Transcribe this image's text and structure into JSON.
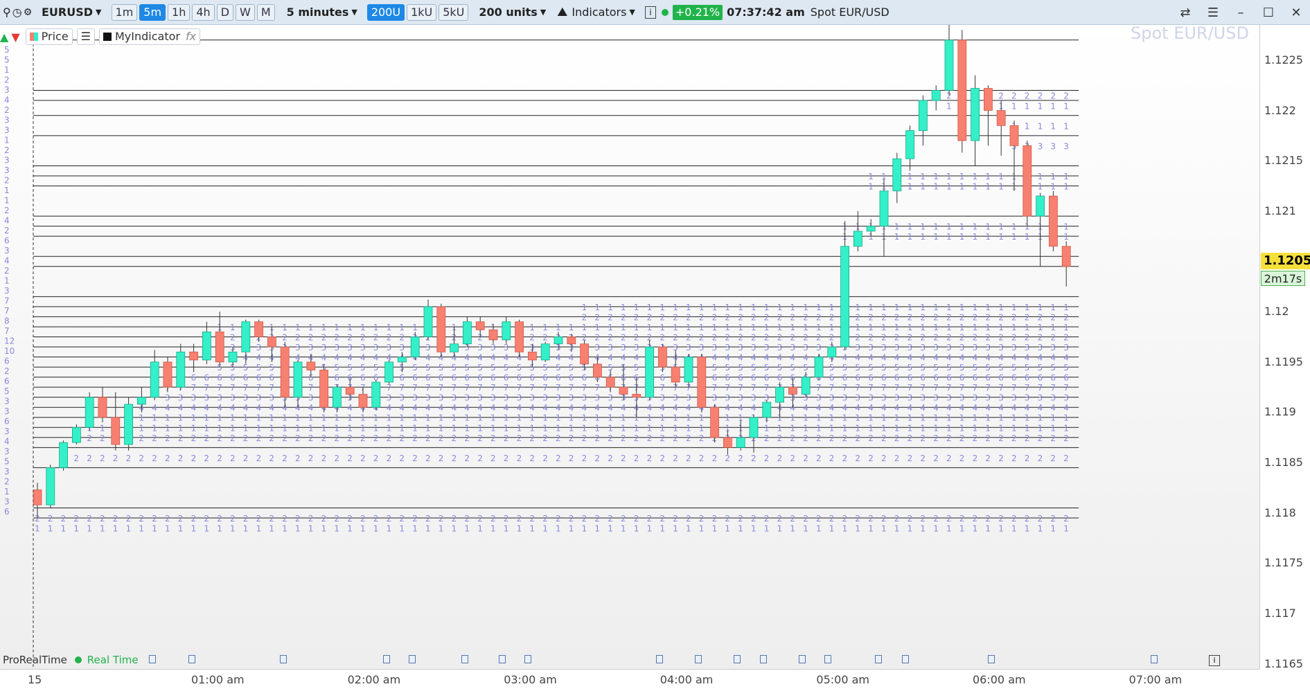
{
  "toolbar": {
    "symbol": "EURUSD",
    "timeframes": [
      "1m",
      "5m",
      "1h",
      "4h",
      "D",
      "W",
      "M"
    ],
    "active_timeframe": "5m",
    "interval": "5 minutes",
    "unit_buttons": [
      "200U",
      "1kU",
      "5kU"
    ],
    "active_unit": "200U",
    "units": "200 units",
    "indicators_label": "Indicators",
    "change": "+0.21%",
    "time": "07:37:42 am",
    "instrument": "Spot EUR/USD"
  },
  "legend": {
    "price_label": "Price",
    "indicator_label": "MyIndicator"
  },
  "watermark": "Spot EUR/USD",
  "current_price": "1.1205",
  "countdown": "2m17s",
  "footer": {
    "brand": "ProRealTime",
    "status": "Real Time"
  },
  "colors": {
    "bull": "#33f0c8",
    "bear": "#f88070",
    "profile_text": "#8888dd",
    "status_green": "#21b34b"
  },
  "chart_data": {
    "type": "candlestick",
    "y_ticks": [
      "1.1225",
      "1.122",
      "1.1215",
      "1.121",
      "1.1205",
      "1.12",
      "1.1195",
      "1.119",
      "1.1185",
      "1.118",
      "1.1175",
      "1.117",
      "1.1165"
    ],
    "x_ticks": [
      "15",
      "01:00 am",
      "02:00 am",
      "03:00 am",
      "04:00 am",
      "05:00 am",
      "06:00 am",
      "07:00 am"
    ],
    "ylim": [
      1.11645,
      1.12285
    ],
    "candles": [
      {
        "o": 1.11823,
        "c": 1.11808,
        "h": 1.1183,
        "l": 1.11795
      },
      {
        "o": 1.11808,
        "c": 1.11845,
        "h": 1.11848,
        "l": 1.11805
      },
      {
        "o": 1.11845,
        "c": 1.1187,
        "h": 1.11872,
        "l": 1.11842
      },
      {
        "o": 1.1187,
        "c": 1.11885,
        "h": 1.11888,
        "l": 1.11868
      },
      {
        "o": 1.11885,
        "c": 1.11915,
        "h": 1.1192,
        "l": 1.11882
      },
      {
        "o": 1.11915,
        "c": 1.11895,
        "h": 1.11925,
        "l": 1.1189
      },
      {
        "o": 1.11895,
        "c": 1.11868,
        "h": 1.1192,
        "l": 1.11862
      },
      {
        "o": 1.11868,
        "c": 1.11908,
        "h": 1.11915,
        "l": 1.11862
      },
      {
        "o": 1.11908,
        "c": 1.11915,
        "h": 1.11925,
        "l": 1.119
      },
      {
        "o": 1.11915,
        "c": 1.1195,
        "h": 1.11962,
        "l": 1.11912
      },
      {
        "o": 1.1195,
        "c": 1.11925,
        "h": 1.11955,
        "l": 1.1192
      },
      {
        "o": 1.11925,
        "c": 1.1196,
        "h": 1.11968,
        "l": 1.11922
      },
      {
        "o": 1.1196,
        "c": 1.11952,
        "h": 1.11968,
        "l": 1.1194
      },
      {
        "o": 1.11952,
        "c": 1.1198,
        "h": 1.1199,
        "l": 1.11948
      },
      {
        "o": 1.1198,
        "c": 1.1195,
        "h": 1.12,
        "l": 1.11945
      },
      {
        "o": 1.1195,
        "c": 1.1196,
        "h": 1.11965,
        "l": 1.11945
      },
      {
        "o": 1.1196,
        "c": 1.1199,
        "h": 1.11992,
        "l": 1.11948
      },
      {
        "o": 1.1199,
        "c": 1.11975,
        "h": 1.11992,
        "l": 1.1197
      },
      {
        "o": 1.11975,
        "c": 1.11965,
        "h": 1.11985,
        "l": 1.1195
      },
      {
        "o": 1.11965,
        "c": 1.11915,
        "h": 1.1197,
        "l": 1.11905
      },
      {
        "o": 1.11915,
        "c": 1.1195,
        "h": 1.11952,
        "l": 1.11905
      },
      {
        "o": 1.1195,
        "c": 1.11942,
        "h": 1.11958,
        "l": 1.11935
      },
      {
        "o": 1.11942,
        "c": 1.11905,
        "h": 1.11948,
        "l": 1.119
      },
      {
        "o": 1.11905,
        "c": 1.11925,
        "h": 1.11928,
        "l": 1.119
      },
      {
        "o": 1.11925,
        "c": 1.11918,
        "h": 1.11935,
        "l": 1.11912
      },
      {
        "o": 1.11918,
        "c": 1.11905,
        "h": 1.11925,
        "l": 1.119
      },
      {
        "o": 1.11905,
        "c": 1.1193,
        "h": 1.11932,
        "l": 1.11902
      },
      {
        "o": 1.1193,
        "c": 1.1195,
        "h": 1.11952,
        "l": 1.11928
      },
      {
        "o": 1.1195,
        "c": 1.11955,
        "h": 1.1196,
        "l": 1.1194
      },
      {
        "o": 1.11955,
        "c": 1.11975,
        "h": 1.1198,
        "l": 1.11952
      },
      {
        "o": 1.11975,
        "c": 1.12005,
        "h": 1.12012,
        "l": 1.11972
      },
      {
        "o": 1.12005,
        "c": 1.1196,
        "h": 1.12008,
        "l": 1.11955
      },
      {
        "o": 1.1196,
        "c": 1.11968,
        "h": 1.11985,
        "l": 1.11955
      },
      {
        "o": 1.11968,
        "c": 1.1199,
        "h": 1.11995,
        "l": 1.11965
      },
      {
        "o": 1.1199,
        "c": 1.11982,
        "h": 1.11995,
        "l": 1.11975
      },
      {
        "o": 1.11982,
        "c": 1.11972,
        "h": 1.11988,
        "l": 1.11968
      },
      {
        "o": 1.11972,
        "c": 1.1199,
        "h": 1.11995,
        "l": 1.11968
      },
      {
        "o": 1.1199,
        "c": 1.1196,
        "h": 1.11992,
        "l": 1.11955
      },
      {
        "o": 1.1196,
        "c": 1.11952,
        "h": 1.11968,
        "l": 1.11945
      },
      {
        "o": 1.11952,
        "c": 1.11968,
        "h": 1.1197,
        "l": 1.1195
      },
      {
        "o": 1.11968,
        "c": 1.11975,
        "h": 1.1198,
        "l": 1.11962
      },
      {
        "o": 1.11975,
        "c": 1.11968,
        "h": 1.11978,
        "l": 1.1196
      },
      {
        "o": 1.11968,
        "c": 1.11948,
        "h": 1.11972,
        "l": 1.11942
      },
      {
        "o": 1.11948,
        "c": 1.11935,
        "h": 1.11955,
        "l": 1.1193
      },
      {
        "o": 1.11935,
        "c": 1.11925,
        "h": 1.11942,
        "l": 1.1192
      },
      {
        "o": 1.11925,
        "c": 1.11918,
        "h": 1.11948,
        "l": 1.11912
      },
      {
        "o": 1.11918,
        "c": 1.11915,
        "h": 1.11935,
        "l": 1.11895
      },
      {
        "o": 1.11915,
        "c": 1.11965,
        "h": 1.11972,
        "l": 1.11912
      },
      {
        "o": 1.11965,
        "c": 1.11945,
        "h": 1.11968,
        "l": 1.1194
      },
      {
        "o": 1.11945,
        "c": 1.1193,
        "h": 1.11962,
        "l": 1.11925
      },
      {
        "o": 1.1193,
        "c": 1.11955,
        "h": 1.11958,
        "l": 1.11925
      },
      {
        "o": 1.11955,
        "c": 1.11905,
        "h": 1.11958,
        "l": 1.119
      },
      {
        "o": 1.11905,
        "c": 1.11875,
        "h": 1.11908,
        "l": 1.1187
      },
      {
        "o": 1.11875,
        "c": 1.11865,
        "h": 1.11882,
        "l": 1.11858
      },
      {
        "o": 1.11865,
        "c": 1.11875,
        "h": 1.11892,
        "l": 1.11862
      },
      {
        "o": 1.11875,
        "c": 1.11895,
        "h": 1.11898,
        "l": 1.1186
      },
      {
        "o": 1.11895,
        "c": 1.1191,
        "h": 1.11912,
        "l": 1.1189
      },
      {
        "o": 1.1191,
        "c": 1.11925,
        "h": 1.1193,
        "l": 1.11895
      },
      {
        "o": 1.11925,
        "c": 1.11918,
        "h": 1.11935,
        "l": 1.11905
      },
      {
        "o": 1.11918,
        "c": 1.11935,
        "h": 1.1194,
        "l": 1.11915
      },
      {
        "o": 1.11935,
        "c": 1.11955,
        "h": 1.11958,
        "l": 1.11932
      },
      {
        "o": 1.11955,
        "c": 1.11965,
        "h": 1.1197,
        "l": 1.1195
      },
      {
        "o": 1.11965,
        "c": 1.12065,
        "h": 1.1209,
        "l": 1.11962
      },
      {
        "o": 1.12065,
        "c": 1.1208,
        "h": 1.121,
        "l": 1.1206
      },
      {
        "o": 1.1208,
        "c": 1.12085,
        "h": 1.12092,
        "l": 1.12075
      },
      {
        "o": 1.12085,
        "c": 1.1212,
        "h": 1.12132,
        "l": 1.12055
      },
      {
        "o": 1.1212,
        "c": 1.12152,
        "h": 1.12158,
        "l": 1.12108
      },
      {
        "o": 1.12152,
        "c": 1.1218,
        "h": 1.12185,
        "l": 1.1214
      },
      {
        "o": 1.1218,
        "c": 1.1221,
        "h": 1.12215,
        "l": 1.12165
      },
      {
        "o": 1.1221,
        "c": 1.1222,
        "h": 1.12225,
        "l": 1.122
      },
      {
        "o": 1.1222,
        "c": 1.1227,
        "h": 1.12285,
        "l": 1.12215
      },
      {
        "o": 1.1227,
        "c": 1.1217,
        "h": 1.1228,
        "l": 1.12158
      },
      {
        "o": 1.1217,
        "c": 1.12222,
        "h": 1.12235,
        "l": 1.12145
      },
      {
        "o": 1.12222,
        "c": 1.122,
        "h": 1.12225,
        "l": 1.12165
      },
      {
        "o": 1.122,
        "c": 1.12185,
        "h": 1.1221,
        "l": 1.12155
      },
      {
        "o": 1.12185,
        "c": 1.12165,
        "h": 1.1219,
        "l": 1.1212
      },
      {
        "o": 1.12165,
        "c": 1.12095,
        "h": 1.1217,
        "l": 1.12085
      },
      {
        "o": 1.12095,
        "c": 1.12115,
        "h": 1.12118,
        "l": 1.12045
      },
      {
        "o": 1.12115,
        "c": 1.12065,
        "h": 1.1212,
        "l": 1.1206
      },
      {
        "o": 1.12065,
        "c": 1.12045,
        "h": 1.1207,
        "l": 1.12025
      }
    ],
    "levels": [
      1.1227,
      1.1222,
      1.1221,
      1.12195,
      1.12175,
      1.12145,
      1.12135,
      1.12125,
      1.12095,
      1.12085,
      1.12075,
      1.12055,
      1.12045,
      1.12015,
      1.12005,
      1.11995,
      1.11985,
      1.11975,
      1.11965,
      1.11955,
      1.11945,
      1.11935,
      1.11925,
      1.11915,
      1.11905,
      1.11895,
      1.11885,
      1.11875,
      1.11865,
      1.11845,
      1.11805,
      1.11795
    ],
    "profile_rows": [
      {
        "p": 1.12215,
        "from": 70,
        "d": "2"
      },
      {
        "p": 1.12205,
        "from": 70,
        "d": "1"
      },
      {
        "p": 1.12185,
        "from": 75,
        "d": "1"
      },
      {
        "p": 1.12165,
        "from": 75,
        "d": "3"
      },
      {
        "p": 1.12135,
        "from": 64,
        "d": "1"
      },
      {
        "p": 1.12125,
        "from": 64,
        "d": "1"
      },
      {
        "p": 1.12085,
        "from": 62,
        "d": "1"
      },
      {
        "p": 1.12075,
        "from": 62,
        "d": "1"
      },
      {
        "p": 1.12005,
        "from": 42,
        "d": "1"
      },
      {
        "p": 1.11995,
        "from": 42,
        "d": "2"
      },
      {
        "p": 1.11985,
        "from": 14,
        "d": "1"
      },
      {
        "p": 1.11975,
        "from": 14,
        "d": "2"
      },
      {
        "p": 1.11965,
        "from": 14,
        "d": "3"
      },
      {
        "p": 1.11955,
        "from": 14,
        "d": "4"
      },
      {
        "p": 1.11945,
        "from": 14,
        "d": "5"
      },
      {
        "p": 1.11935,
        "from": 10,
        "d": "6"
      },
      {
        "p": 1.11925,
        "from": 10,
        "d": "7"
      },
      {
        "p": 1.11915,
        "from": 10,
        "d": "3"
      },
      {
        "p": 1.11905,
        "from": 8,
        "d": "4"
      },
      {
        "p": 1.11895,
        "from": 8,
        "d": "1"
      },
      {
        "p": 1.11885,
        "from": 4,
        "d": "1"
      },
      {
        "p": 1.11875,
        "from": 4,
        "d": "2"
      },
      {
        "p": 1.11855,
        "from": 3,
        "d": "2"
      },
      {
        "p": 1.11795,
        "from": 0,
        "d": "2"
      },
      {
        "p": 1.11785,
        "from": 0,
        "d": "1"
      }
    ],
    "left_digits": [
      "5",
      "5",
      "1",
      "2",
      "3",
      "4",
      "2",
      "3",
      "3",
      "1",
      "2",
      "3",
      "3",
      "2",
      "1",
      "1",
      "2",
      "4",
      "2",
      "6",
      "3",
      "4",
      "2",
      "1",
      "3",
      "7",
      "7",
      "8",
      "7",
      "12",
      "10",
      "6",
      "2",
      "6",
      "5",
      "3",
      "3",
      "6",
      "3",
      "4",
      "3",
      "5",
      "3",
      "2",
      "1",
      "3",
      "6"
    ]
  }
}
